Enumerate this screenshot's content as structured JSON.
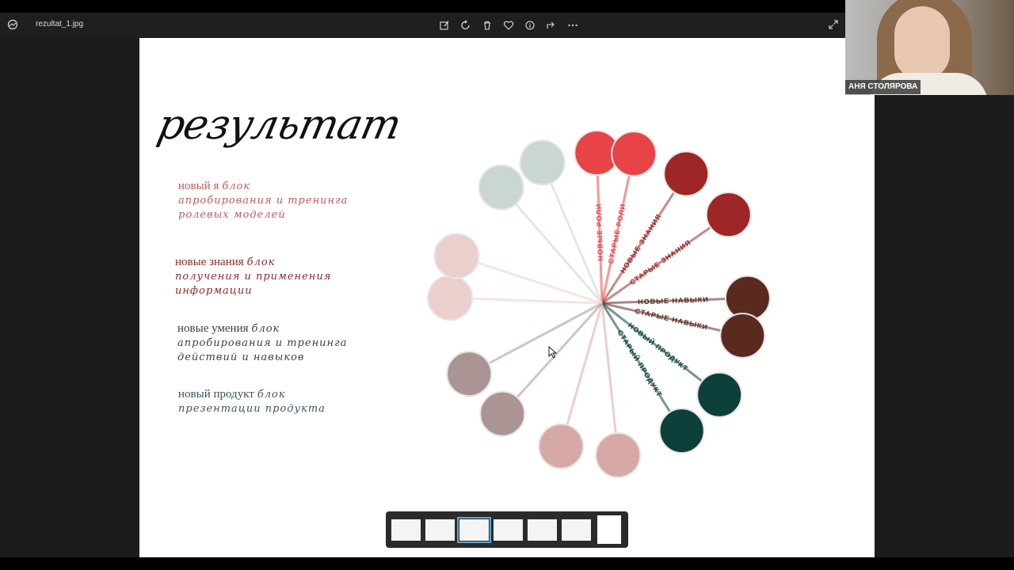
{
  "window": {
    "filename": "rezultat_1.jpg"
  },
  "toolbar": {
    "icons": [
      "edit-image-icon",
      "rotate-icon",
      "delete-icon",
      "favorite-icon",
      "info-icon",
      "share-icon",
      "more-icon"
    ],
    "expand_icon": "expand-icon"
  },
  "webcam": {
    "participant_name": "АНЯ СТОЛЯРОВА"
  },
  "slide": {
    "title": "результат",
    "blocks": [
      {
        "label": "новый я",
        "script": "блок",
        "script2": "апробирования и тренинга",
        "script3": "ролевых моделей",
        "color": "#c45a5a"
      },
      {
        "label": "новые знания",
        "script": "блок",
        "script2": "получения и применения",
        "script3": "информации",
        "color": "#8e2a2a"
      },
      {
        "label": "новые умения",
        "script": "блок",
        "script2": "апробирования и тренинга",
        "script3": "действий и навыков",
        "color": "#4a3a35"
      },
      {
        "label": "новый продукт",
        "script": "блок",
        "script2": "презентации продукта",
        "script3": "",
        "color": "#3f5360"
      }
    ],
    "wheel": {
      "spokes": [
        {
          "label": "НОВЫЕ РОЛИ",
          "color": "#e84346"
        },
        {
          "label": "СТАРЫЕ РОЛИ",
          "color": "#e84346"
        },
        {
          "label": "НОВЫЕ ЗНАНИЯ",
          "color": "#9e2626"
        },
        {
          "label": "СТАРЫЕ ЗНАНИЯ",
          "color": "#9e2626"
        },
        {
          "label": "НОВЫЕ НАВЫКИ",
          "color": "#5a2a1f"
        },
        {
          "label": "СТАРЫЕ НАВЫКИ",
          "color": "#5a2a1f"
        },
        {
          "label": "НОВЫЙ ПРОДУКТ",
          "color": "#0d3f3b"
        },
        {
          "label": "СТАРЫЙ ПРОДУКТ",
          "color": "#0d3f3b"
        },
        {
          "label": "",
          "color": "#d6a9a7"
        },
        {
          "label": "",
          "color": "#d6a9a7"
        },
        {
          "label": "",
          "color": "#ab9494"
        },
        {
          "label": "",
          "color": "#ab9494"
        },
        {
          "label": "",
          "color": "#ebcfcc"
        },
        {
          "label": "",
          "color": "#ebcfcc"
        },
        {
          "label": "",
          "color": "#c9d6d4"
        },
        {
          "label": "",
          "color": "#c9d6d4"
        }
      ]
    }
  },
  "filmstrip": {
    "count": 7,
    "active_index": 2
  }
}
